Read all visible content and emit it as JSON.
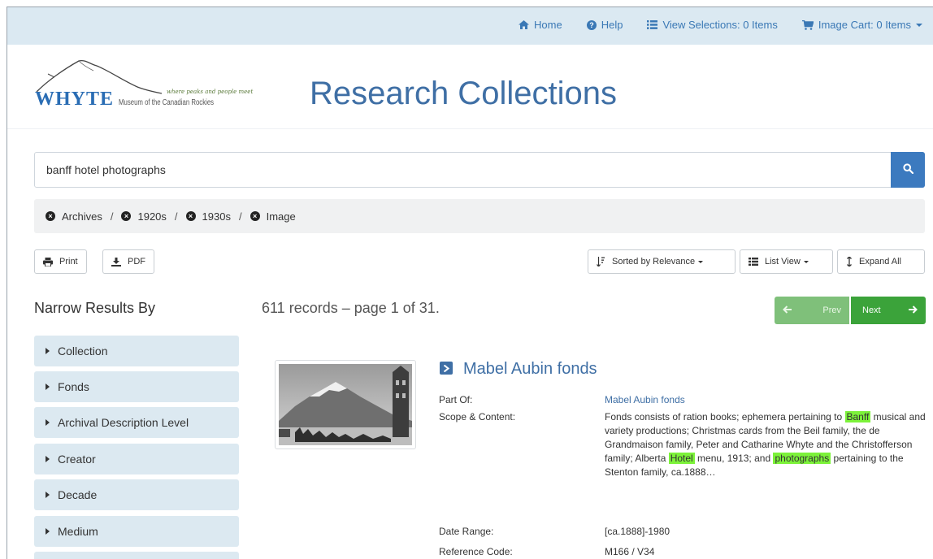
{
  "nav": {
    "home": "Home",
    "help": "Help",
    "view_selections": "View Selections: 0 Items",
    "image_cart": "Image Cart: 0 Items"
  },
  "header": {
    "logo_name": "WHYTE",
    "logo_text": "Museum of the Canadian Rockies",
    "logo_tagline": "where peaks and people meet",
    "title": "Research Collections"
  },
  "search": {
    "value": "banff hotel photographs"
  },
  "breadcrumb": {
    "items": [
      "Archives",
      "1920s",
      "1930s",
      "Image"
    ],
    "separator": "/"
  },
  "toolbar": {
    "print": "Print",
    "pdf": "PDF",
    "sort": "Sorted by Relevance",
    "view": "List View",
    "expand": "Expand All"
  },
  "sidebar": {
    "title": "Narrow Results By",
    "facets": [
      "Collection",
      "Fonds",
      "Archival Description Level",
      "Creator",
      "Decade",
      "Medium"
    ]
  },
  "results": {
    "summary": "611 records – page 1 of 31.",
    "prev": "Prev",
    "next": "Next"
  },
  "record": {
    "title": "Mabel Aubin fonds",
    "part_of_label": "Part Of:",
    "part_of_value": "Mabel Aubin fonds",
    "scope_label": "Scope & Content:",
    "scope_parts": [
      "Fonds consists of ration books; ephemera pertaining to ",
      "Banff",
      " musical and variety productions; Christmas cards from the Beil family, the de Grandmaison family, Peter and Catharine Whyte and the Christofferson family; Alberta ",
      "Hotel",
      " menu, 1913; and ",
      "photographs",
      " pertaining to the Stenton family, ca.1888…"
    ],
    "date_label": "Date Range:",
    "date_value": "[ca.1888]-1980",
    "ref_label": "Reference Code:",
    "ref_value": "M166 / V34"
  },
  "colors": {
    "accent": "#3f6fa5",
    "topbar": "#dbe9f2",
    "highlight": "#7cf23a",
    "next_button": "#3ba33a",
    "prev_button": "#7fc07a"
  }
}
